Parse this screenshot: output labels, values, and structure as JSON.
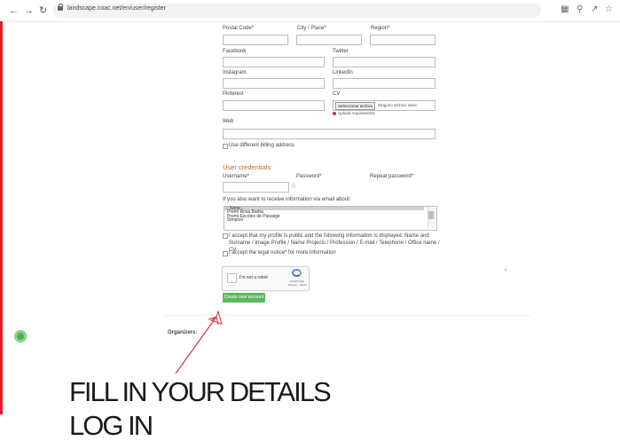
{
  "browser": {
    "url": "landscape.coac.net/en/user/register"
  },
  "form": {
    "postal_code_label": "Postal Code*",
    "city_label": "City / Place*",
    "region_label": "Region*",
    "facebook_label": "Facebook",
    "twitter_label": "Twitter",
    "instagram_label": "Instagram",
    "linkedin_label": "LinkedIn",
    "pinterest_label": "Pinterest",
    "cv_label": "CV",
    "file_button": "Seleccionar archivo",
    "file_status": "Ninguno archivo selec.",
    "upload_requirements": "Upload requirements",
    "web_label": "Web",
    "billing_checkbox": "Use different billing address"
  },
  "credentials": {
    "title": "User credentials",
    "username_label": "Username*",
    "password_label": "Password*",
    "repeat_password_label": "Repeat password*",
    "info_prompt": "If you also want to receive information via email about:",
    "options": [
      "- None -",
      "Premi Rosa Barba",
      "Premi Escoles de Paisatge",
      "Simposi"
    ],
    "profile_consent": "I accept that my profile is public and the following information is displayed: Name and Surname / Image Profile / Name Projects / Profession / E-mail / Telephone / Office name / CV",
    "legal_consent": "I accept the legal notice* for more information"
  },
  "recaptcha": {
    "label": "I'm not a robot",
    "brand": "reCAPTCHA",
    "terms": "Privacy - Terms"
  },
  "create_button": "Create new account",
  "organizers_label": "Organizers:",
  "annotation": {
    "line1": "FILL IN YOUR DETAILS",
    "line2": "LOG IN",
    "arrow_color": "#e03030"
  },
  "colors": {
    "accent": "#c8641e",
    "button": "#5cb85c",
    "side_bar": "#e21b2d"
  }
}
